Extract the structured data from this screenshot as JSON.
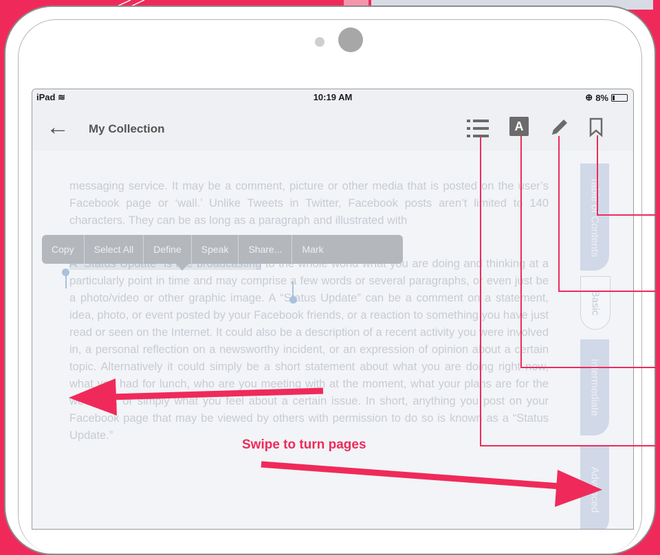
{
  "status_bar": {
    "device": "iPad",
    "time": "10:19 AM",
    "battery": "8%"
  },
  "nav": {
    "back_icon": "arrow-left-icon",
    "title": "My Collection"
  },
  "toolbar_icons": [
    "list-icon",
    "font-a-icon",
    "pencil-icon",
    "bookmark-icon"
  ],
  "font_icon_letter": "A",
  "content": {
    "para1": "messaging service. It may be a comment, picture or other media that is posted on the user’s Facebook page or ‘wall.’ Unlike Tweets in Twitter, Facebook posts aren’t limited to 140 characters. They can be as long as a paragraph and illustrated with",
    "highlighted": "A “Status Update” is like broadcasting",
    "para2": " to the whole world what you are doing and thinking at a particularly point in time and may comprise a few words or several paragraphs, or even just be a photo/video or other graphic image. A “Status Update” can be a comment on a statement, idea, photo, or event posted by your Facebook friends, or a reaction to something you have just read or seen on the Internet. It could also be a description of a recent activity you were involved in, a personal reflection on a newsworthy incident, or an expression of opinion about a certain topic. Alternatively it could simply be a short statement about what you are doing right now, what you had for lunch, who are you meeting with at the moment, what your plans are for the weekend, or simply what you feel about a certain issue. In short, anything you post on your Facebook page that may be viewed by others with permission to do so is known as a “Status Update.”"
  },
  "context_menu": [
    "Copy",
    "Select All",
    "Define",
    "Speak",
    "Share...",
    "Mark"
  ],
  "side_tabs": {
    "toc": "Table of Contents",
    "basic": "Basic",
    "intermediate": "Intermediate",
    "advanced": "Advanced"
  },
  "annotation": {
    "swipe": "Swipe to turn pages"
  },
  "colors": {
    "accent": "#ef2a5a",
    "screen_bg": "#f2f4f7",
    "tab_bg": "#d1d8e8"
  }
}
